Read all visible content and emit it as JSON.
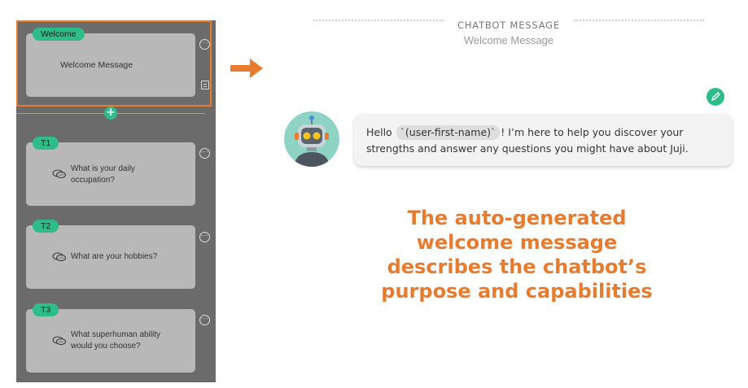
{
  "left_panel": {
    "welcome_card": {
      "tag": "Welcome",
      "text": "Welcome Message"
    },
    "topics": [
      {
        "tag": "T1",
        "text_line1": "What is your daily",
        "text_line2": "occupation?"
      },
      {
        "tag": "T2",
        "text_line1": "What are your hobbies?",
        "text_line2": ""
      },
      {
        "tag": "T3",
        "text_line1": "What superhuman ability",
        "text_line2": "would you choose?"
      }
    ],
    "add_symbol": "+"
  },
  "message_header": {
    "title": "CHATBOT MESSAGE",
    "subtitle": "Welcome Message"
  },
  "chat_bubble": {
    "prefix": "Hello ",
    "variable": "`(user-first-name)`",
    "suffix_line1": "! I’m here to help you discover your",
    "line2": "strengths and answer any questions you might have about Juji."
  },
  "caption": {
    "line1": "The auto-generated",
    "line2": "welcome message",
    "line3": "describes the chatbot’s",
    "line4": "purpose and capabilities"
  },
  "colors": {
    "accent": "#2ebd8a",
    "highlight": "#e87c2e",
    "panel": "#6b6b6b",
    "card": "#b8b8b8"
  },
  "icons": [
    "more-options-icon",
    "note-icon",
    "chat-bubbles-icon",
    "add-icon",
    "pencil-icon",
    "robot-avatar-icon",
    "arrow-right-icon"
  ]
}
